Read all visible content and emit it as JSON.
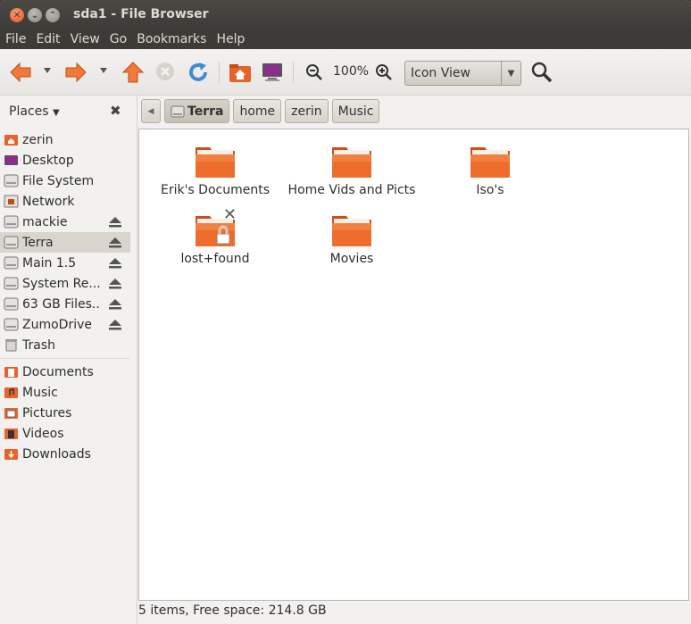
{
  "window": {
    "title": "sda1 - File Browser"
  },
  "menu": [
    "File",
    "Edit",
    "View",
    "Go",
    "Bookmarks",
    "Help"
  ],
  "toolbar": {
    "zoom": "100%",
    "view_mode": "Icon View"
  },
  "sidebar": {
    "header": "Places",
    "places": [
      {
        "label": "zerin",
        "icon": "home-folder-icon",
        "eject": false,
        "selected": false
      },
      {
        "label": "Desktop",
        "icon": "desktop-icon",
        "eject": false,
        "selected": false
      },
      {
        "label": "File System",
        "icon": "drive-icon",
        "eject": false,
        "selected": false
      },
      {
        "label": "Network",
        "icon": "network-icon",
        "eject": false,
        "selected": false
      },
      {
        "label": "mackie",
        "icon": "drive-icon",
        "eject": true,
        "selected": false
      },
      {
        "label": "Terra",
        "icon": "drive-icon",
        "eject": true,
        "selected": true
      },
      {
        "label": "Main 1.5",
        "icon": "drive-icon",
        "eject": true,
        "selected": false
      },
      {
        "label": "System Re...",
        "icon": "drive-icon",
        "eject": true,
        "selected": false
      },
      {
        "label": "63 GB Files...",
        "icon": "drive-icon",
        "eject": true,
        "selected": false
      },
      {
        "label": "ZumoDrive",
        "icon": "drive-icon",
        "eject": true,
        "selected": false
      },
      {
        "label": "Trash",
        "icon": "trash-icon",
        "eject": false,
        "selected": false
      }
    ],
    "bookmarks": [
      {
        "label": "Documents",
        "icon": "documents-folder-icon"
      },
      {
        "label": "Music",
        "icon": "music-folder-icon"
      },
      {
        "label": "Pictures",
        "icon": "pictures-folder-icon"
      },
      {
        "label": "Videos",
        "icon": "videos-folder-icon"
      },
      {
        "label": "Downloads",
        "icon": "downloads-folder-icon"
      }
    ]
  },
  "pathbar": {
    "crumbs": [
      "Terra",
      "home",
      "zerin",
      "Music"
    ]
  },
  "files": [
    {
      "name": "Erik's Documents",
      "locked": false
    },
    {
      "name": "Home Vids and Picts",
      "locked": false
    },
    {
      "name": "Iso's",
      "locked": false
    },
    {
      "name": "lost+found",
      "locked": true
    },
    {
      "name": "Movies",
      "locked": false
    }
  ],
  "status": {
    "text": "5 items, Free space: 214.8 GB"
  }
}
